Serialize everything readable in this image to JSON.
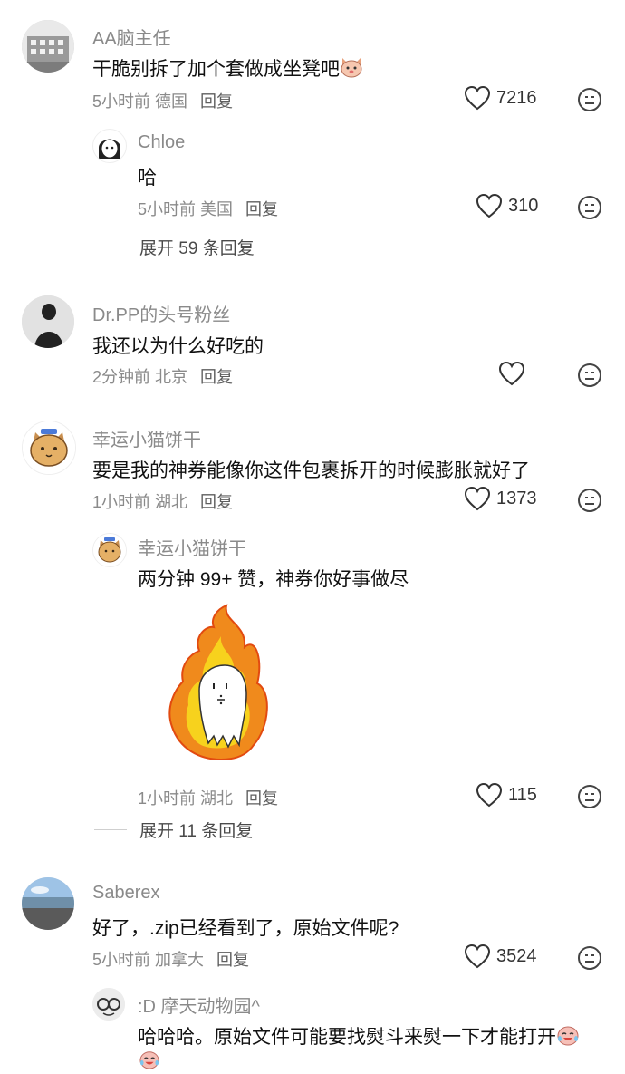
{
  "comments": [
    {
      "name": "AA脑主任",
      "text": "干脆别拆了加个套做成坐凳吧",
      "time": "5小时前 德国",
      "reply": "回复",
      "likes": "7216"
    },
    {
      "name": "Dr.PP的头号粉丝",
      "text": "我还以为什么好吃的",
      "time": "2分钟前 北京",
      "reply": "回复",
      "likes": ""
    },
    {
      "name": "幸运小猫饼干",
      "text": "要是我的神券能像你这件包裹拆开的时候膨胀就好了",
      "time": "1小时前 湖北",
      "reply": "回复",
      "likes": "1373"
    },
    {
      "name": "Saberex",
      "text": "好了，.zip已经看到了，原始文件呢?",
      "time": "5小时前 加拿大",
      "reply": "回复",
      "likes": "3524"
    }
  ],
  "replies": [
    {
      "name": "Chloe",
      "text": "哈",
      "time": "5小时前 美国",
      "reply": "回复",
      "likes": "310"
    },
    {
      "name": "幸运小猫饼干",
      "text": "两分钟 99+ 赞，神券你好事做尽",
      "time": "1小时前 湖北",
      "reply": "回复",
      "likes": "115"
    },
    {
      "name": ":D 摩天动物园^",
      "text": "哈哈哈。原始文件可能要找熨斗来熨一下才能打开",
      "time": "",
      "reply": "",
      "likes": ""
    }
  ],
  "expand": [
    {
      "label": "展开 59 条回复"
    },
    {
      "label": "展开 11 条回复"
    }
  ],
  "colors": {
    "meta": "#8a8a8a",
    "text": "#111111",
    "fire_outer": "#f08a1c",
    "fire_inner": "#f7d21d"
  }
}
